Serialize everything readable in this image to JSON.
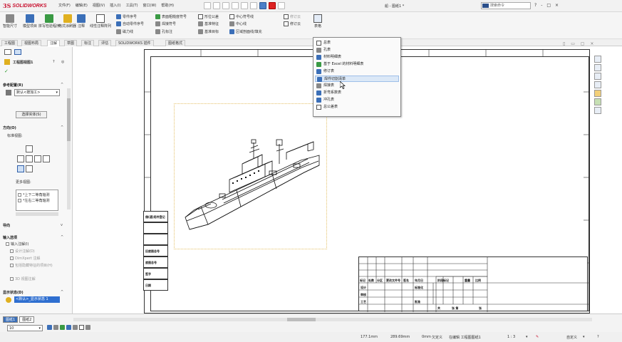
{
  "app": {
    "logo_prefix": "3S",
    "logo_name": "SOLIDWORKS",
    "document_title": "船 - 图纸1 *",
    "search_placeholder": "搜索命令",
    "help_controls": [
      "?",
      "-",
      "□",
      "×"
    ]
  },
  "menu": [
    "文件(F)",
    "编辑(E)",
    "视图(V)",
    "插入(I)",
    "工具(T)",
    "窗口(W)",
    "帮助(H)"
  ],
  "commands": {
    "smart_dimension": "智能尺寸",
    "model_items": "模型项目",
    "spell_check": "拼写检验程序",
    "format_painter": "格式涂刷器",
    "note": "注释",
    "linear_note_pattern": "线性注释阵列",
    "balloon": "零件序号",
    "auto_balloon": "自动零件序号",
    "magnetic_line": "磁力线",
    "surface_finish": "表面粗糙度符号",
    "weld_symbol": "焊接符号",
    "hole_callout": "孔标注",
    "geometric_tolerance": "形位公差",
    "datum_feature": "基准特征",
    "datum_target": "基准目标",
    "blocks": "块",
    "center_mark": "中心符号线",
    "centerline": "中心线",
    "area_hatch": "区域剖面线/填充",
    "revision_cloud": "修订云",
    "cosmetic": "修订云",
    "tables": "表格"
  },
  "tabs": [
    "工程图",
    "视图布局",
    "注解",
    "草图",
    "标注",
    "评估",
    "SOLIDWORKS 插件",
    "图纸格式"
  ],
  "active_tab_index": 2,
  "left_panel": {
    "title": "工程图视图1",
    "reference_config_label": "参考配置(R)",
    "config_value": "默认<按加工>",
    "select_body_button": "选择实体(S)",
    "orientation_label": "方向(O)",
    "standard_views_label": "标准视图:",
    "more_views_label": "更多视图:",
    "more_views_items": [
      "*上下二等角轴测",
      "*左右二等角轴测"
    ],
    "import_label": "导向",
    "import_options_label": "输入选项",
    "import_annotations": "输入注解(I)",
    "design_annotations": "设计注解(D)",
    "dimxpert_annotations": "DimXpert 注解",
    "include_hidden": "包括隐藏特征的项目(H)",
    "3d_view_annotations": "3D 视图注解",
    "display_state_label": "显示状态(D)",
    "display_state_value": "<默认>_显示状态 1"
  },
  "dropdown": {
    "items": [
      {
        "label": "总表",
        "icon": "general-table-icon"
      },
      {
        "label": "孔表",
        "icon": "hole-table-icon"
      },
      {
        "label": "材料明细表",
        "icon": "bom-icon"
      },
      {
        "label": "基于 Excel 的材料明细表",
        "icon": "excel-bom-icon"
      },
      {
        "label": "修订表",
        "icon": "revision-table-icon"
      },
      {
        "label": "焊件切割清单",
        "icon": "weldment-cutlist-icon"
      },
      {
        "label": "焊接表",
        "icon": "weld-table-icon"
      },
      {
        "label": "折弯系数表",
        "icon": "bend-table-icon"
      },
      {
        "label": "冲孔表",
        "icon": "punch-table-icon"
      },
      {
        "label": "总公差表",
        "icon": "tolerance-table-icon"
      }
    ],
    "hover_index": 5
  },
  "sheet_tabs": [
    "图纸1",
    "图纸2"
  ],
  "zoom_value": "10",
  "status": {
    "x_coord": "177.1mm",
    "y_coord": "289.69mm",
    "z_coord": "0mm",
    "defined_state": "欠定义",
    "editing": "在编辑 工程图图纸1",
    "scale": "1 : 3",
    "units": "自定义"
  },
  "title_block": {
    "row_labels": [
      "标记",
      "处数",
      "分区",
      "更改文件号",
      "签名",
      "年月日"
    ],
    "design_labels": [
      "设计",
      "审核",
      "工艺"
    ],
    "approve_label": "批准",
    "standard_label": "标准化",
    "stage_headers": [
      "阶段标记",
      "重量",
      "比例"
    ],
    "sheet_label": "共",
    "sheet_of_label": "张 第",
    "page_label": "张"
  },
  "left_table": {
    "labels": [
      "借(通)用件登记",
      "旧底图总号",
      "底图总号",
      "签字",
      "日期"
    ]
  }
}
